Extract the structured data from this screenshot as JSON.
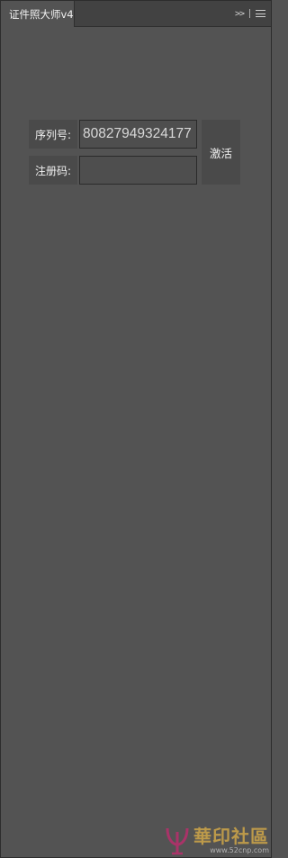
{
  "panel": {
    "tab_title": "证件照大师v4",
    "collapse_symbol": ">>"
  },
  "form": {
    "serial_label": "序列号:",
    "serial_value": "80827949324177",
    "regcode_label": "注册码:",
    "regcode_value": "",
    "activate_label": "激活"
  },
  "watermark": {
    "title": "華印社區",
    "url": "www.52cnp.com",
    "accent_color": "#c9a24a"
  }
}
